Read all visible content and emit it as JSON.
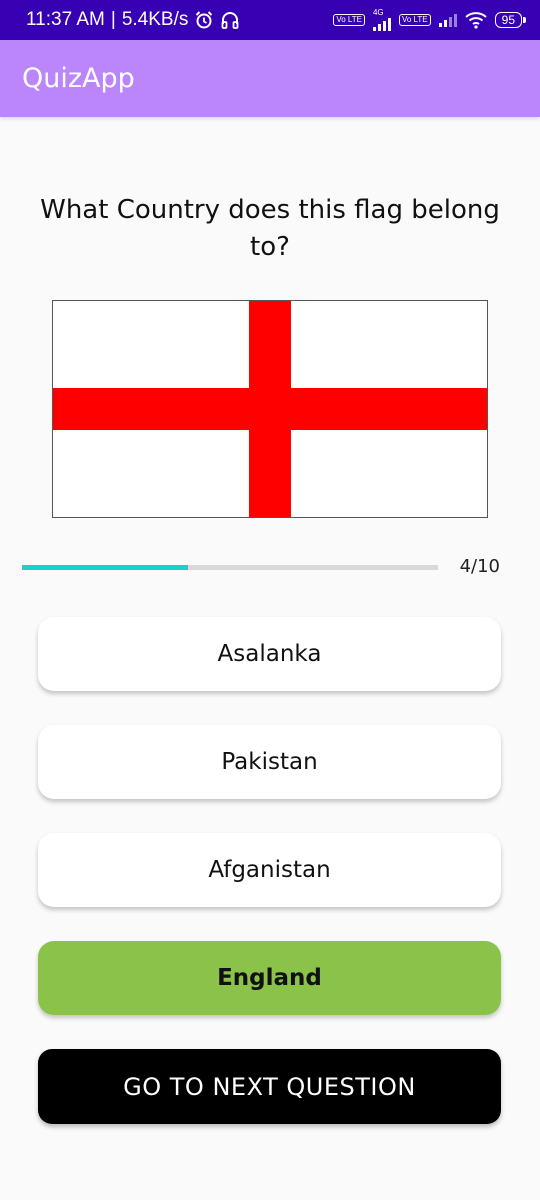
{
  "status_bar": {
    "time": "11:37 AM",
    "separator": "|",
    "speed": "5.4KB/s",
    "network_type": "4G",
    "volte_label": "Vo LTE",
    "battery": "95"
  },
  "app_bar": {
    "title": "QuizApp"
  },
  "quiz": {
    "question": "What Country does this flag belong to?",
    "progress_value": 4,
    "progress_max": 10,
    "progress_text": "4/10",
    "progress_fraction": 0.4,
    "options": [
      {
        "label": "Asalanka",
        "state": "normal"
      },
      {
        "label": "Pakistan",
        "state": "normal"
      },
      {
        "label": "Afganistan",
        "state": "normal"
      },
      {
        "label": "England",
        "state": "correct"
      }
    ],
    "next_button_label": "GO TO NEXT QUESTION"
  },
  "colors": {
    "status_bar_bg": "#3700b3",
    "app_bar_bg": "#bb86fc",
    "correct_option_bg": "#8bc34a",
    "progress_fill": "#1ad1c6",
    "flag_cross": "#ff0000",
    "next_button_bg": "#000000"
  },
  "icons": {
    "flag": "england-flag",
    "alarm": "alarm-icon",
    "headphones": "headphones-icon",
    "wifi": "wifi-icon"
  }
}
